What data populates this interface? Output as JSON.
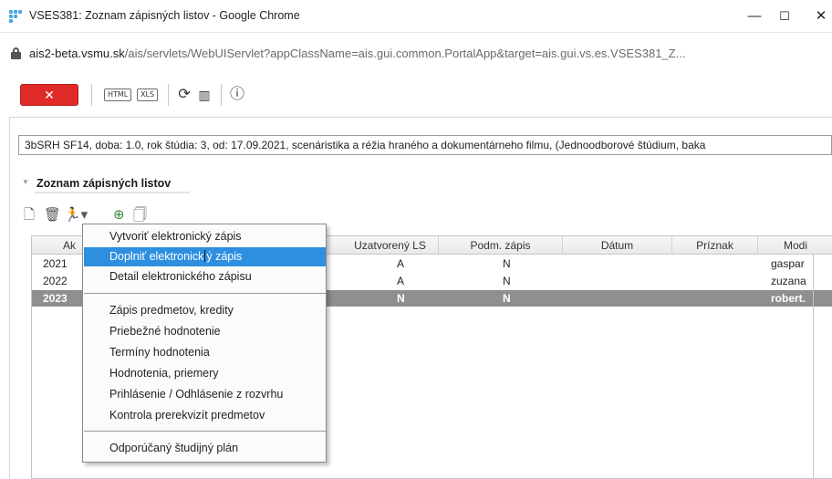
{
  "window": {
    "title": "VSES381: Zoznam zápisných listov - Google Chrome",
    "minimize": "—",
    "maximize": "☐",
    "close": "✕"
  },
  "urlbar": {
    "host": "ais2-beta.vsmu.sk",
    "path": "/ais/servlets/WebUIServlet?appClassName=ais.gui.common.PortalApp&target=ais.gui.vs.es.VSES381_Z..."
  },
  "toolbar": {
    "close_label": "✕",
    "html_label": "HTML",
    "xls_label": "XLS",
    "refresh_glyph": "⟳",
    "chart_glyph": "▥",
    "info_glyph": "ⓘ"
  },
  "info_strip": "3bSRH SF14, doba: 1.0, rok štúdia: 3, od: 17.09.2021, scenáristika a réžia hraného a dokumentárneho filmu, (Jednoodborové štúdium, baka",
  "section": {
    "title": "Zoznam zápisných listov"
  },
  "table": {
    "headers": {
      "ak": "Ak",
      "uzatvoreny": "Uzatvorený LS",
      "podm": "Podm. zápis",
      "datum": "Dátum",
      "priznak": "Príznak",
      "modi": "Modi"
    },
    "rows": [
      {
        "ak": "2021",
        "uzatvoreny": "A",
        "podm": "N",
        "datum": "",
        "priznak": "",
        "modi": "gaspar"
      },
      {
        "ak": "2022",
        "uzatvoreny": "A",
        "podm": "N",
        "datum": "",
        "priznak": "",
        "modi": "zuzana"
      },
      {
        "ak": "2023",
        "uzatvoreny": "N",
        "podm": "N",
        "datum": "",
        "priznak": "",
        "modi": "robert."
      }
    ]
  },
  "menu": {
    "items": [
      "Vytvoriť elektronický zápis",
      "Doplniť elektronický zápis",
      "Detail elektronického zápisu",
      "Zápis predmetov, kredity",
      "Priebežné hodnotenie",
      "Termíny hodnotenia",
      "Hodnotenia, priemery",
      "Prihlásenie / Odhlásenie z rozvrhu",
      "Kontrola prerekvizít predmetov",
      "Odporúčaný študijný plán"
    ],
    "highlight_part1": "Doplniť elektronick",
    "highlight_part2": "ý zápis",
    "highlight_color": "#2e8fe0"
  }
}
